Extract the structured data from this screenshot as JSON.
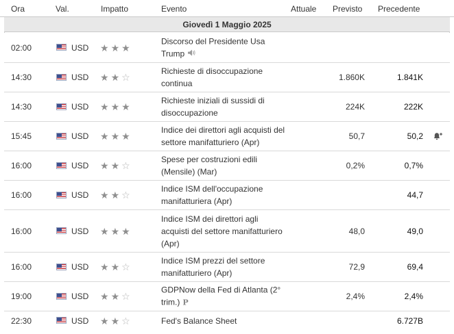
{
  "columns": {
    "ora": "Ora",
    "val": "Val.",
    "impatto": "Impatto",
    "evento": "Evento",
    "attuale": "Attuale",
    "previsto": "Previsto",
    "precedente": "Precedente"
  },
  "date": "Giovedì 1 Maggio 2025",
  "colors": {
    "header_bg": "#e8e8e8",
    "border": "#c9c9c9",
    "star": "#8f8f8f"
  },
  "events": [
    {
      "time": "02:00",
      "currency": "USD",
      "stars": 3,
      "event": "Discorso del Presidente Usa Trump",
      "icon": "speaker-icon",
      "previsto": "",
      "precedente": ""
    },
    {
      "time": "14:30",
      "currency": "USD",
      "stars": 2,
      "event": "Richieste di disoccupazione continua",
      "previsto": "1.860K",
      "precedente": "1.841K"
    },
    {
      "time": "14:30",
      "currency": "USD",
      "stars": 3,
      "event": "Richieste iniziali di sussidi di disoccupazione",
      "previsto": "224K",
      "precedente": "222K"
    },
    {
      "time": "15:45",
      "currency": "USD",
      "stars": 3,
      "event": "Indice dei direttori agli acquisti del settore manifatturiero (Apr)",
      "previsto": "50,7",
      "precedente": "50,2",
      "icon": "bell-plus-icon"
    },
    {
      "time": "16:00",
      "currency": "USD",
      "stars": 2,
      "event": "Spese per costruzioni edili (Mensile) (Mar)",
      "previsto": "0,2%",
      "precedente": "0,7%"
    },
    {
      "time": "16:00",
      "currency": "USD",
      "stars": 2,
      "event": "Indice ISM dell'occupazione manifatturiera (Apr)",
      "previsto": "",
      "precedente": "44,7"
    },
    {
      "time": "16:00",
      "currency": "USD",
      "stars": 3,
      "event": "Indice ISM dei direttori agli acquisti del settore manifatturiero (Apr)",
      "previsto": "48,0",
      "precedente": "49,0"
    },
    {
      "time": "16:00",
      "currency": "USD",
      "stars": 2,
      "event": "Indice ISM prezzi del settore manifatturiero (Apr)",
      "previsto": "72,9",
      "precedente": "69,4"
    },
    {
      "time": "19:00",
      "currency": "USD",
      "stars": 2,
      "event": "GDPNow della Fed di Atlanta (2° trim.)",
      "icon": "preliminary-icon",
      "previsto": "2,4%",
      "precedente": "2,4%"
    },
    {
      "time": "22:30",
      "currency": "USD",
      "stars": 2,
      "event": "Fed's Balance Sheet",
      "previsto": "",
      "precedente": "6.727B"
    }
  ]
}
